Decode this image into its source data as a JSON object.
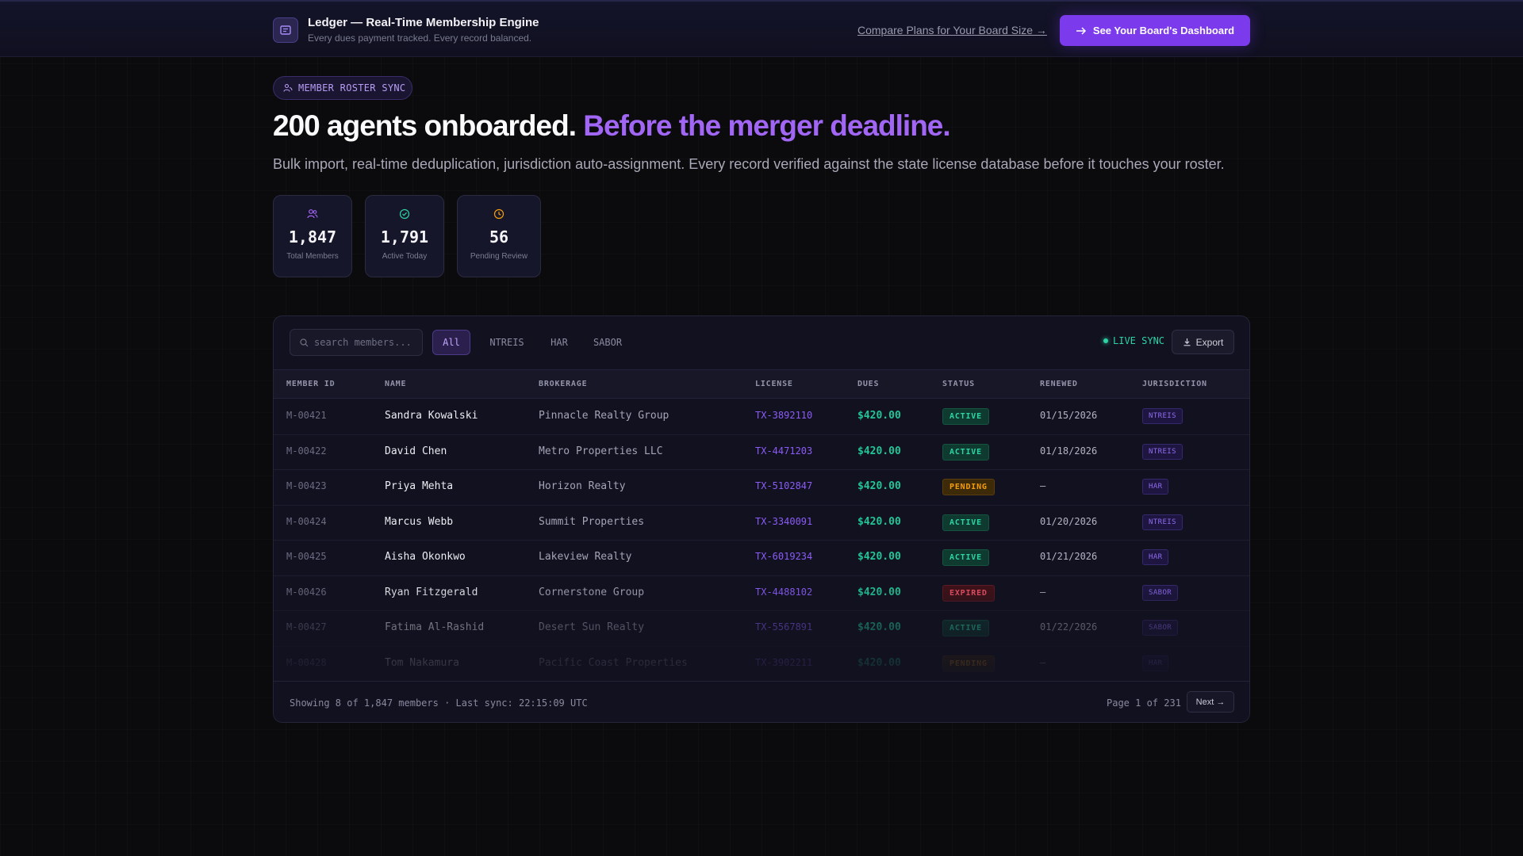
{
  "header": {
    "brand_icon": "ledger-icon",
    "title": "Ledger — Real-Time Membership Engine",
    "subtitle": "Every dues payment tracked. Every record balanced.",
    "compare_link": "Compare Plans for Your Board Size →",
    "cta_label": "See Your Board's Dashboard",
    "cta_icon": "arrow-right-icon"
  },
  "hero": {
    "badge_icon": "users-icon",
    "badge_label": "MEMBER ROSTER SYNC",
    "headline_white": "200 agents onboarded.",
    "headline_purple": "Before the merger deadline.",
    "subhead": "Bulk import, real-time deduplication, jurisdiction auto-assignment. Every record verified against the state license database before it touches your roster."
  },
  "stats": [
    {
      "value": "1,847",
      "label": "Total Members",
      "icon": "users-icon",
      "color": "#a266f5"
    },
    {
      "value": "1,791",
      "label": "Active Today",
      "icon": "check-circle-icon",
      "color": "#2dd4a4"
    },
    {
      "value": "56",
      "label": "Pending Review",
      "icon": "clock-icon",
      "color": "#f59e0b"
    }
  ],
  "toolbar": {
    "search_placeholder": "search members...",
    "filters": [
      "All",
      "NTREIS",
      "HAR",
      "SABOR"
    ],
    "active_filter": "All",
    "live_sync": "LIVE SYNC",
    "export_label": "Export"
  },
  "table": {
    "columns": [
      "MEMBER ID",
      "NAME",
      "BROKERAGE",
      "LICENSE",
      "DUES",
      "STATUS",
      "RENEWED",
      "JURISDICTION"
    ],
    "rows": [
      {
        "id": "M-00421",
        "name": "Sandra Kowalski",
        "brokerage": "Pinnacle Realty Group",
        "license": "TX-3892110",
        "dues": "$420.00",
        "status": "ACTIVE",
        "renewed": "01/15/2026",
        "jurisdiction": "NTREIS"
      },
      {
        "id": "M-00422",
        "name": "David Chen",
        "brokerage": "Metro Properties LLC",
        "license": "TX-4471203",
        "dues": "$420.00",
        "status": "ACTIVE",
        "renewed": "01/18/2026",
        "jurisdiction": "NTREIS"
      },
      {
        "id": "M-00423",
        "name": "Priya Mehta",
        "brokerage": "Horizon Realty",
        "license": "TX-5102847",
        "dues": "$420.00",
        "status": "PENDING",
        "renewed": "—",
        "jurisdiction": "HAR"
      },
      {
        "id": "M-00424",
        "name": "Marcus Webb",
        "brokerage": "Summit Properties",
        "license": "TX-3340091",
        "dues": "$420.00",
        "status": "ACTIVE",
        "renewed": "01/20/2026",
        "jurisdiction": "NTREIS"
      },
      {
        "id": "M-00425",
        "name": "Aisha Okonkwo",
        "brokerage": "Lakeview Realty",
        "license": "TX-6019234",
        "dues": "$420.00",
        "status": "ACTIVE",
        "renewed": "01/21/2026",
        "jurisdiction": "HAR"
      },
      {
        "id": "M-00426",
        "name": "Ryan Fitzgerald",
        "brokerage": "Cornerstone Group",
        "license": "TX-4488102",
        "dues": "$420.00",
        "status": "EXPIRED",
        "renewed": "—",
        "jurisdiction": "SABOR"
      },
      {
        "id": "M-00427",
        "name": "Fatima Al-Rashid",
        "brokerage": "Desert Sun Realty",
        "license": "TX-5567891",
        "dues": "$420.00",
        "status": "ACTIVE",
        "renewed": "01/22/2026",
        "jurisdiction": "SABOR"
      },
      {
        "id": "M-00428",
        "name": "Tom Nakamura",
        "brokerage": "Pacific Coast Properties",
        "license": "TX-3902211",
        "dues": "$420.00",
        "status": "PENDING",
        "renewed": "—",
        "jurisdiction": "HAR"
      }
    ]
  },
  "footer": {
    "showing": "Showing 8 of 1,847 members · Last sync: 22:15:09 UTC",
    "page": "Page 1 of 231",
    "next_label": "Next →"
  },
  "colors": {
    "accent": "#7c3aed",
    "headline_accent": "#a266f5",
    "success": "#2dd4a4",
    "warning": "#f59e0b",
    "danger": "#f05266",
    "background": "#0b0b0e"
  }
}
